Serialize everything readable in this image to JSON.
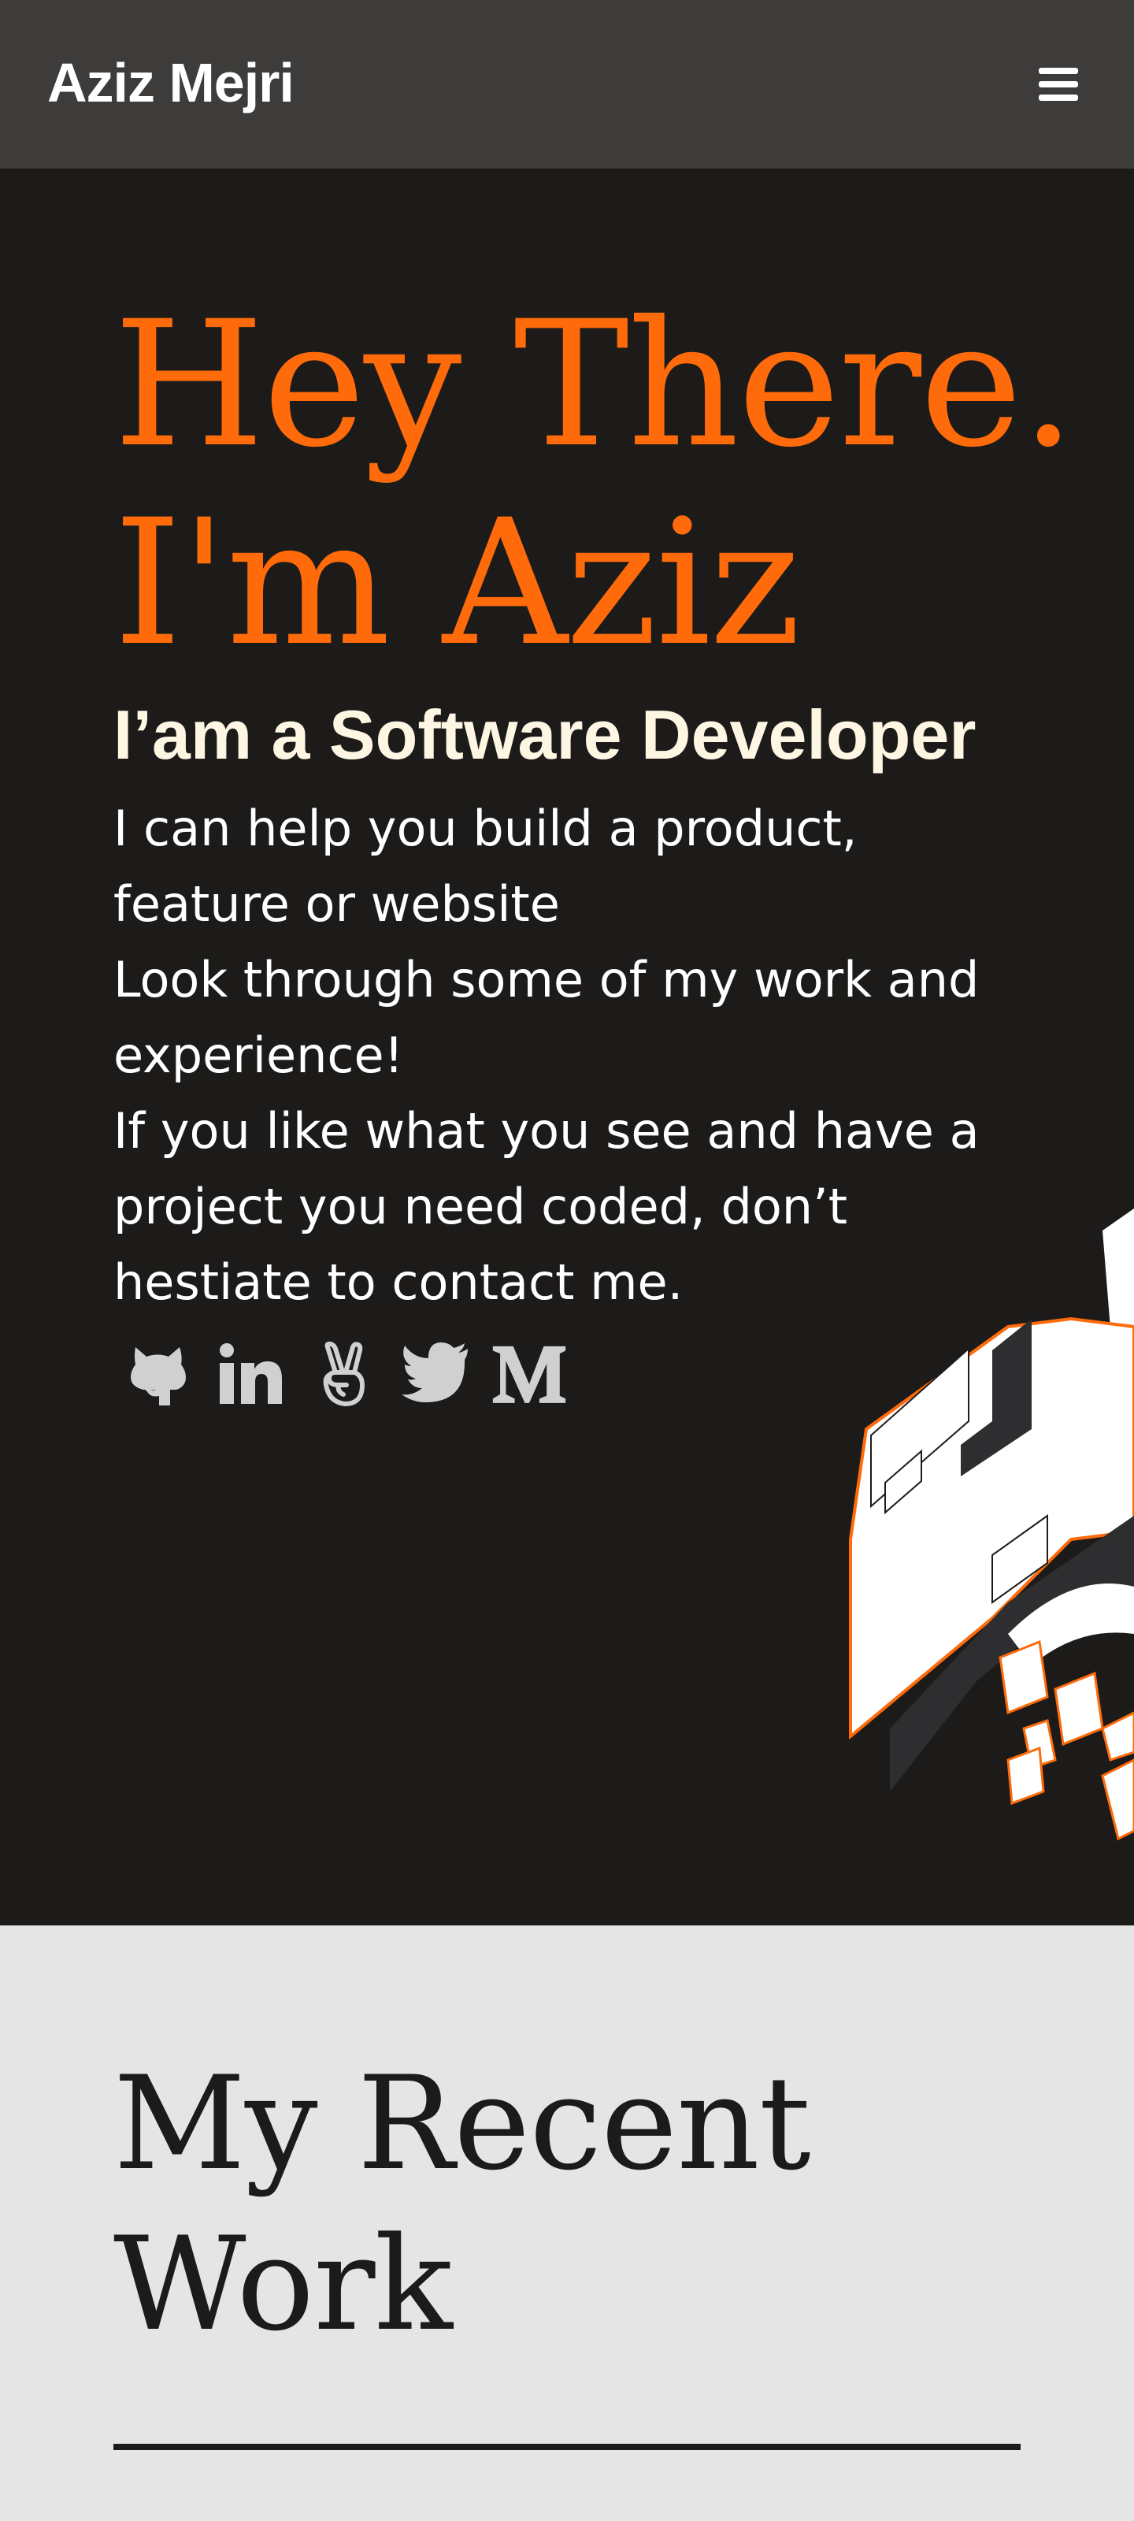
{
  "navbar": {
    "brand": "Aziz Mejri",
    "menu_icon": "hamburger-menu-icon"
  },
  "hero": {
    "title_line1": "Hey There.",
    "title_line2": "I'm Aziz",
    "role": "I’am a Software Developer",
    "lines": [
      "I can help you build a product,",
      "feature or website",
      "Look through some of my work and",
      "experience!",
      "If you like what you see and have a",
      "project you need coded, don’t",
      "hestiate to contact me."
    ],
    "socials": [
      {
        "icon": "github-icon"
      },
      {
        "icon": "linkedin-icon"
      },
      {
        "icon": "angellist-icon"
      },
      {
        "icon": "twitter-icon"
      },
      {
        "icon": "medium-icon"
      }
    ]
  },
  "work": {
    "title_line1": "My Recent",
    "title_line2": "Work"
  },
  "colors": {
    "accent": "#ff6b0a",
    "dark_bg": "#1c1b1a",
    "nav_bg": "#3d3c3b",
    "role_text": "#fdf6e3",
    "light_section_bg": "#e5e5e5",
    "icon_gray": "#d0d0d0"
  }
}
